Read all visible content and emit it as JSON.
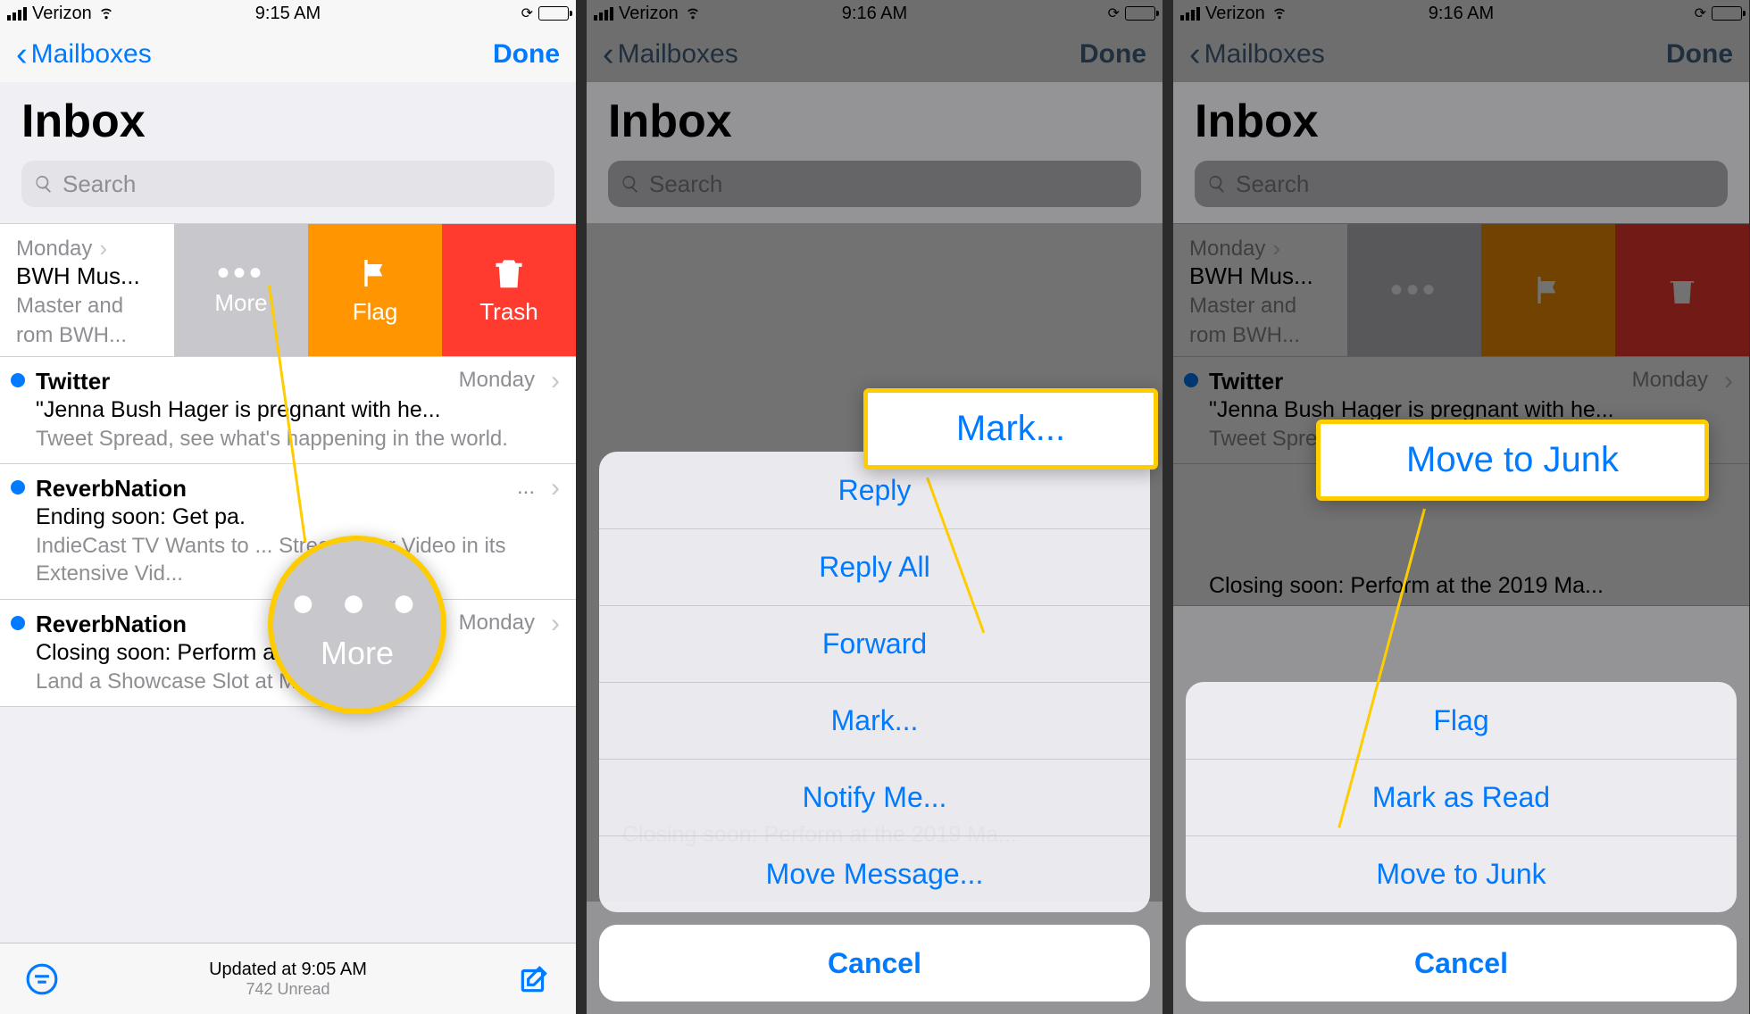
{
  "s1": {
    "carrier": "Verizon",
    "time": "9:15 AM",
    "back": "Mailboxes",
    "done": "Done",
    "title": "Inbox",
    "search": "Search",
    "status_updated": "Updated at 9:05 AM",
    "status_unread": "742 Unread",
    "swipe": {
      "more": "More",
      "flag": "Flag",
      "trash": "Trash"
    },
    "magnifier_label": "More",
    "rows": [
      {
        "sender": "BWH Mus...",
        "subject": "Master and",
        "preview": "rom BWH...",
        "date": "Monday",
        "unread": false,
        "truncated": true
      },
      {
        "sender": "Twitter",
        "subject": "\"Jenna Bush Hager is pregnant with he...",
        "preview": "Tweet Spread, see what's happening in the world.",
        "date": "Monday",
        "unread": true
      },
      {
        "sender": "ReverbNation",
        "subject": "Ending soon: Get pa.",
        "preview": "IndieCast TV Wants to ... Stream your Video in its Extensive Vid...",
        "date": "...",
        "unread": true
      },
      {
        "sender": "ReverbNation",
        "subject": "Closing soon: Perform at the 2019 Ma...",
        "preview": "Land a Showcase Slot at Making The",
        "date": "Monday",
        "unread": true
      }
    ]
  },
  "s2": {
    "carrier": "Verizon",
    "time": "9:16 AM",
    "back": "Mailboxes",
    "done": "Done",
    "title": "Inbox",
    "search": "Search",
    "callout_label": "Mark...",
    "sheet": {
      "items": [
        "Reply",
        "Reply All",
        "Forward",
        "Mark...",
        "Notify Me...",
        "Move Message..."
      ],
      "cancel": "Cancel"
    },
    "bg_row_text": "Closing soon: Perform at the 2019 Ma..."
  },
  "s3": {
    "carrier": "Verizon",
    "time": "9:16 AM",
    "back": "Mailboxes",
    "done": "Done",
    "title": "Inbox",
    "search": "Search",
    "callout_label": "Move to Junk",
    "sheet": {
      "items": [
        "Flag",
        "Mark as Read",
        "Move to Junk"
      ],
      "cancel": "Cancel"
    },
    "rows": [
      {
        "sender": "BWH Mus...",
        "subject": "Master and",
        "preview": "rom BWH...",
        "date": "Monday",
        "unread": false
      },
      {
        "sender": "Twitter",
        "subject": "\"Jenna Bush Hager is pregnant with he...",
        "preview": "Tweet Spread, see what's happening in",
        "date": "Monday",
        "unread": true
      }
    ],
    "bg_row_text": "Closing soon: Perform at the 2019 Ma..."
  }
}
